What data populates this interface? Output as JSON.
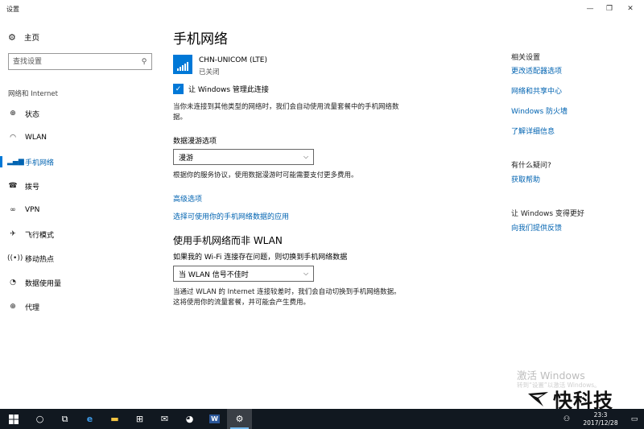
{
  "window": {
    "title": "设置",
    "controls": [
      "—",
      "❐",
      "✕"
    ]
  },
  "sidebar": {
    "home_label": "主页",
    "search_placeholder": "查找设置",
    "section": "网络和 Internet",
    "items": [
      {
        "label": "状态",
        "icon": "status-icon"
      },
      {
        "label": "WLAN",
        "icon": "wifi-icon"
      },
      {
        "label": "手机网络",
        "icon": "cellular-icon"
      },
      {
        "label": "拨号",
        "icon": "dialup-icon"
      },
      {
        "label": "VPN",
        "icon": "vpn-icon"
      },
      {
        "label": "飞行模式",
        "icon": "airplane-icon"
      },
      {
        "label": "移动热点",
        "icon": "hotspot-icon"
      },
      {
        "label": "数据使用量",
        "icon": "data-usage-icon"
      },
      {
        "label": "代理",
        "icon": "globe-icon"
      }
    ]
  },
  "main": {
    "title": "手机网络",
    "network_name": "CHN-UNICOM (LTE)",
    "network_status": "已关闭",
    "manage_checkbox_label": "让 Windows 管理此连接",
    "manage_desc": "当你未连接到其他类型的网络时，我们会自动使用流量套餐中的手机网络数据。",
    "roaming_label": "数据漫游选项",
    "roaming_value": "漫游",
    "roaming_desc": "根据你的服务协议，使用数据漫游时可能需要支付更多费用。",
    "advanced_link": "高级选项",
    "apps_link": "选择可使用你的手机网络数据的应用",
    "wlan_section_title": "使用手机网络而非 WLAN",
    "wlan_label": "如果我的 Wi-Fi 连接存在问题，则切换到手机网络数据",
    "wlan_value": "当 WLAN 信号不佳时",
    "wlan_desc": "当通过 WLAN 的 Internet 连接较差时，我们会自动切换到手机网络数据。这将使用你的流量套餐，并可能会产生费用。"
  },
  "related": {
    "head": "相关设置",
    "links": [
      "更改适配器选项",
      "网络和共享中心",
      "Windows 防火墙",
      "了解详细信息"
    ],
    "question_head": "有什么疑问?",
    "question_link": "获取帮助",
    "improve_head": "让 Windows 变得更好",
    "improve_link": "向我们提供反馈"
  },
  "watermark": {
    "activate_title": "激活 Windows",
    "activate_sub": "转到“设置”以激活 Windows。",
    "brand": "快科技"
  },
  "taskbar": {
    "time": "23:3",
    "date": "2017/12/28"
  },
  "colors": {
    "accent": "#0078d7",
    "link": "#0063b1",
    "taskbar": "#111820"
  }
}
